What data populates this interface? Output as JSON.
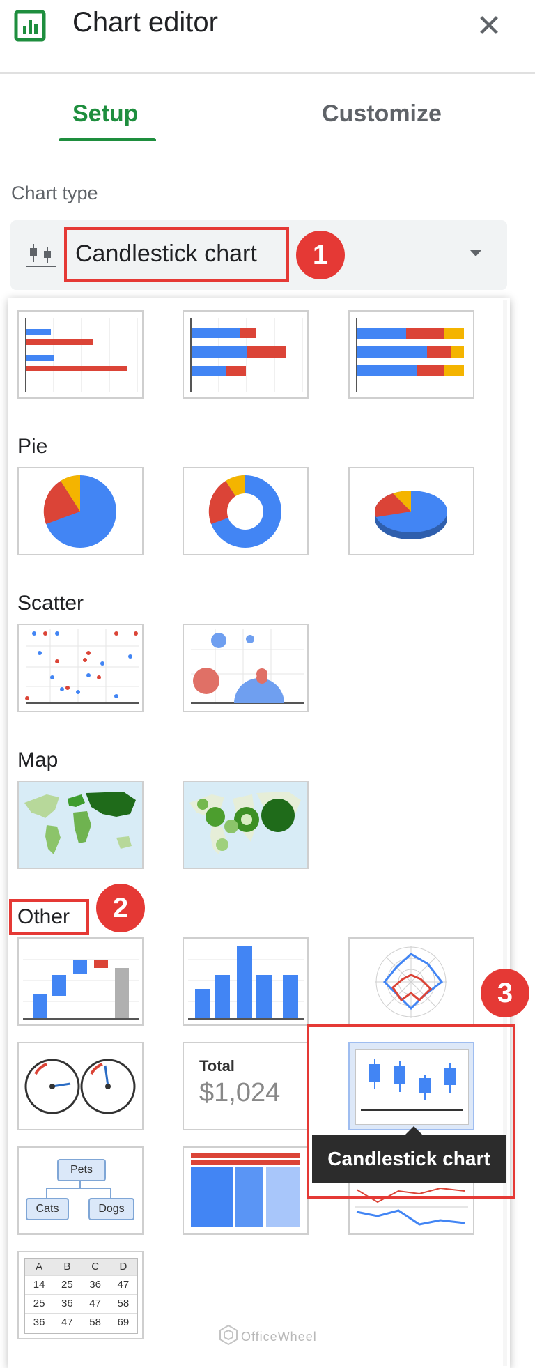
{
  "header": {
    "title": "Chart editor",
    "app_icon": "sheets-chart-icon",
    "close_icon": "close-icon",
    "close_symbol": "✕"
  },
  "tabs": [
    {
      "label": "Setup",
      "active": true
    },
    {
      "label": "Customize",
      "active": false
    }
  ],
  "chart_type": {
    "label": "Chart type",
    "selected": "Candlestick chart",
    "icon": "candlestick-icon"
  },
  "sections": [
    {
      "label": "Pie"
    },
    {
      "label": "Scatter"
    },
    {
      "label": "Map"
    },
    {
      "label": "Other"
    }
  ],
  "thumbs": {
    "scorecard_title": "Total",
    "scorecard_value": "$1,024",
    "org_top": "Pets",
    "org_left": "Cats",
    "org_right": "Dogs",
    "table_header": [
      "A",
      "B",
      "C",
      "D"
    ],
    "table_rows": [
      [
        "14",
        "25",
        "36",
        "47"
      ],
      [
        "25",
        "36",
        "47",
        "58"
      ],
      [
        "36",
        "47",
        "58",
        "69"
      ]
    ]
  },
  "tooltip": "Candlestick chart",
  "annotations": {
    "step1": "1",
    "step2": "2",
    "step3": "3"
  },
  "watermark": "OfficeWheel",
  "colors": {
    "accent": "#1e8e3e",
    "highlight": "#e53935",
    "blue": "#4285f4",
    "red": "#db4437",
    "yellow": "#f4b400",
    "green": "#0f9d58"
  }
}
